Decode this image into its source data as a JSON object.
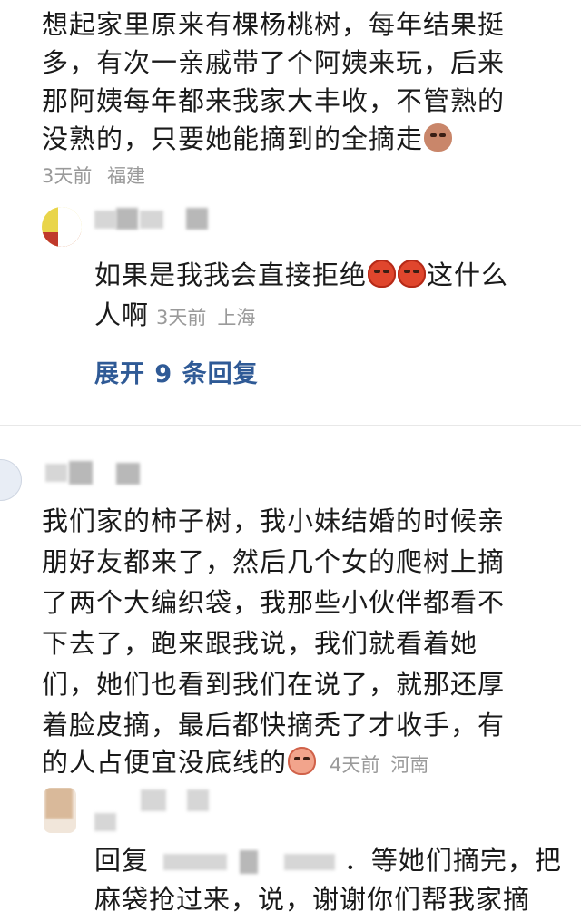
{
  "comments": [
    {
      "lines": [
        "想起家里原来有棵杨桃树，每年结果挺",
        "多，有次一亲戚带了个阿姨来玩，后来",
        "那阿姨每年都来我家大丰收，不管熟的",
        "没熟的，只要她能摘到的全摘走"
      ],
      "emoji": "smirk-emoji",
      "time": "3天前",
      "location": "福建",
      "reply": {
        "lines": [
          "如果是我我会直接拒绝",
          "这什么",
          "人啊"
        ],
        "emoji": "angry-emoji",
        "time": "3天前",
        "location": "上海"
      },
      "expand_label": "展开 9 条回复"
    },
    {
      "lines": [
        "我们家的柿子树，我小妹结婚的时候亲",
        "朋好友都来了，然后几个女的爬树上摘",
        "了两个大编织袋，我那些小伙伴都看不",
        "下去了，跑来跟我说，我们就看着她",
        "们，她们也看到我们在说了，就那还厚",
        "着脸皮摘，最后都快摘秃了才收手，有",
        "的人占便宜没底线的"
      ],
      "emoji": "crying-emoji",
      "time": "4天前",
      "location": "河南",
      "reply": {
        "lines": [
          "回复",
          "．等她们摘完，把",
          "麻袋抢过来，说，谢谢你们帮我家摘"
        ]
      }
    }
  ]
}
